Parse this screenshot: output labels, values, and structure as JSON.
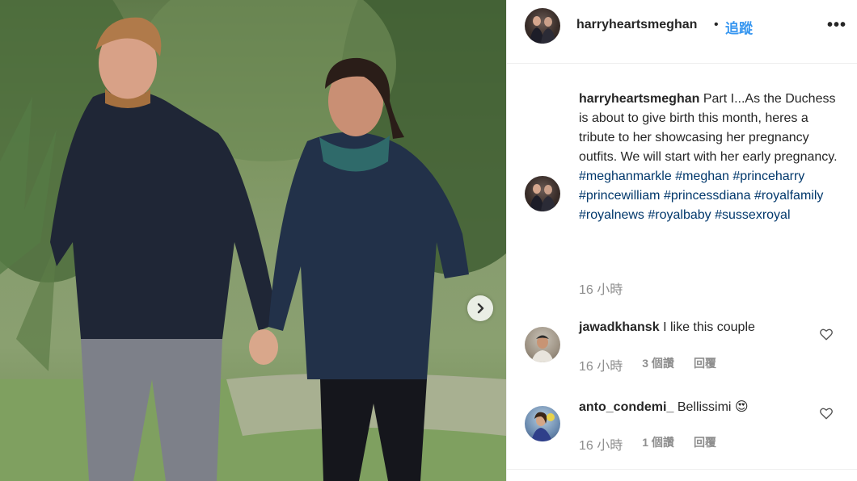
{
  "post": {
    "username": "harryheartsmeghan",
    "dot": "•",
    "follow_label": "追蹤",
    "more_label": "•••"
  },
  "caption": {
    "username": "harryheartsmeghan",
    "text": "Part I...As the Duchess is about to give birth this month, heres a tribute to her showcasing her pregnancy outfits. We will start with her early pregnancy.",
    "hashtags": [
      "#meghanmarkle",
      "#meghan",
      "#princeharry",
      "#princewilliam",
      "#princessdiana",
      "#royalfamily",
      "#royalnews",
      "#royalbaby",
      "#sussexroyal"
    ],
    "time": "16 小時"
  },
  "comments": [
    {
      "username": "jawadkhansk",
      "text": "I like this couple",
      "time": "16 小時",
      "likes": "3 個讚",
      "reply": "回覆"
    },
    {
      "username": "anto_condemi_",
      "text": "Bellissimi 😍",
      "time": "16 小時",
      "likes": "1 個讚",
      "reply": "回覆"
    }
  ],
  "icons": {
    "next": "chevron-right-icon",
    "like": "heart-icon",
    "more": "more-options-icon"
  },
  "colors": {
    "link": "#3897f0",
    "hashtag": "#00376b",
    "muted": "#8e8e8e",
    "text": "#262626"
  }
}
